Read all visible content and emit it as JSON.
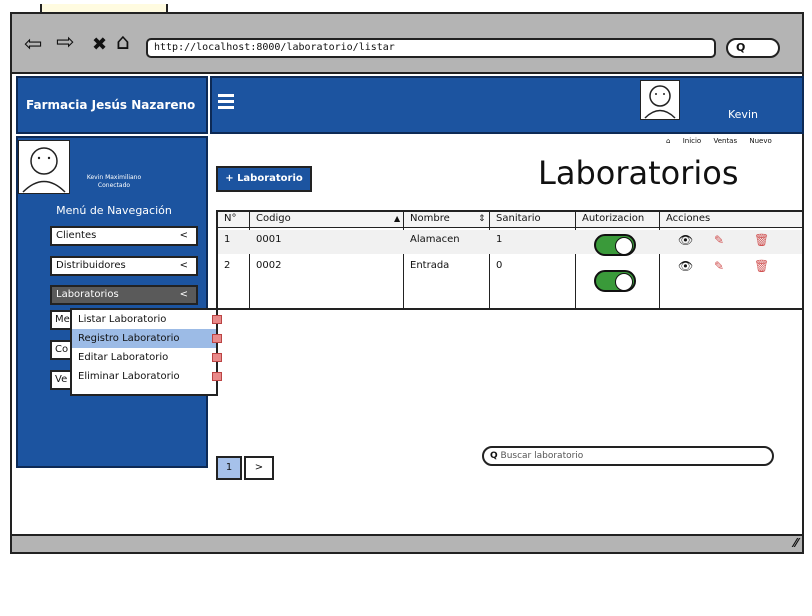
{
  "browser": {
    "url": "http://localhost:8000/laboratorio/listar",
    "search_label": "Q"
  },
  "brand": {
    "title": "Farmacia Jesús Nazareno"
  },
  "header": {
    "username": "Kevin"
  },
  "sidebar": {
    "user_name": "Kevin Maximiliano",
    "user_status": "Conectado",
    "menu_title": "Menú de Navegación",
    "items": [
      {
        "label": "Clientes",
        "chevron": "<"
      },
      {
        "label": "Distribuidores",
        "chevron": "<"
      },
      {
        "label": "Laboratorios",
        "chevron": "<"
      }
    ],
    "stubs": [
      "Me",
      "Co",
      "Ve"
    ]
  },
  "dropdown": {
    "items": [
      "Listar Laboratorio",
      "Registro Laboratorio",
      "Editar Laboratorio",
      "Eliminar Laboratorio"
    ]
  },
  "breadcrumbs": [
    "Inicio",
    "Ventas",
    "Nuevo"
  ],
  "main": {
    "add_button": "+ Laboratorio",
    "title": "Laboratorios"
  },
  "table": {
    "headers": [
      "N°",
      "Codigo",
      "Nombre",
      "Sanitario",
      "Autorizacion",
      "Acciones"
    ],
    "rows": [
      {
        "num": "1",
        "codigo": "0001",
        "nombre": "Alamacen",
        "sanitario": "1",
        "autorizacion": "on"
      },
      {
        "num": "2",
        "codigo": "0002",
        "nombre": "Entrada",
        "sanitario": "0",
        "autorizacion": "on"
      }
    ]
  },
  "pagination": {
    "current": "1",
    "next": ">"
  },
  "search": {
    "placeholder": "Buscar laboratorio"
  },
  "colors": {
    "primary": "#1c54a0",
    "toggle_on": "#3a9a3a",
    "chrome": "#b4b4b4"
  }
}
